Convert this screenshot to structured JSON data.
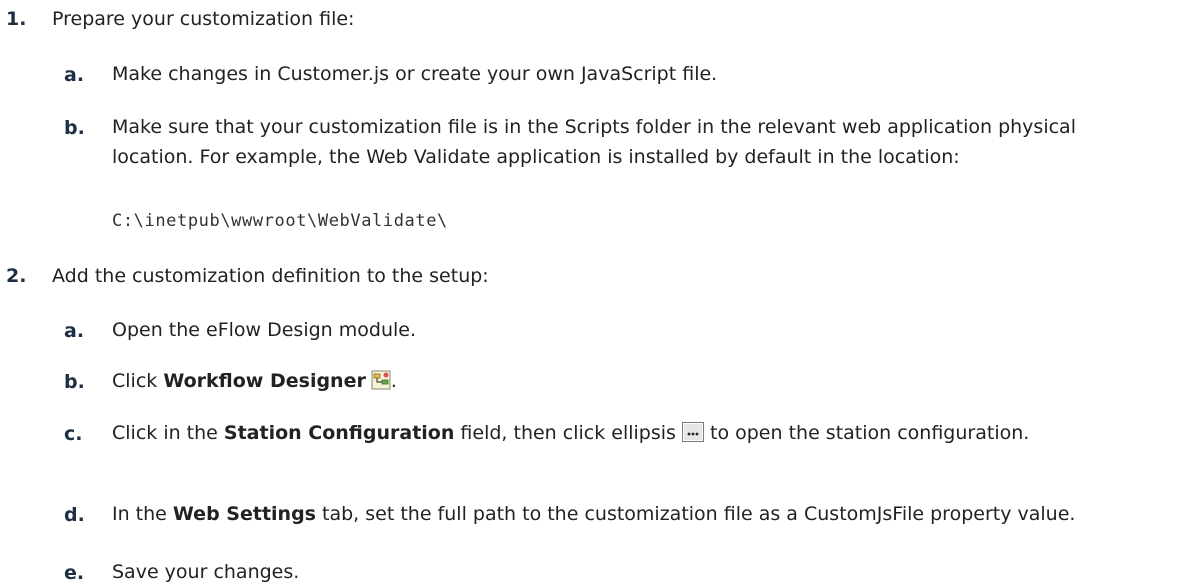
{
  "steps": [
    {
      "number": "1.",
      "text": "Prepare your customization file:",
      "substeps": [
        {
          "letter": "a.",
          "text": "Make changes in Customer.js or create your own JavaScript file."
        },
        {
          "letter": "b.",
          "text": "Make sure that your customization file is in the Scripts folder in the relevant web application physical location. For example, the Web Validate application is installed by default in the location:",
          "code": "C:\\inetpub\\wwwroot\\WebValidate\\"
        }
      ]
    },
    {
      "number": "2.",
      "text": "Add the customization definition to the setup:",
      "substeps": [
        {
          "letter": "a.",
          "text": "Open the eFlow Design module."
        },
        {
          "letter": "b.",
          "prefix": "Click ",
          "bold": "Workflow Designer",
          "suffix": "."
        },
        {
          "letter": "c.",
          "prefix": "Click in the ",
          "bold": "Station Configuration",
          "middle": " field, then click ellipsis ",
          "suffix": " to open the station configuration."
        },
        {
          "letter": "d.",
          "prefix": "In the ",
          "bold": "Web Settings",
          "suffix": " tab, set the full path to the customization file as a CustomJsFile property value."
        },
        {
          "letter": "e.",
          "text": "Save your changes."
        }
      ]
    }
  ],
  "icons": {
    "workflow_designer": "workflow-designer-icon",
    "ellipsis": "ellipsis-button-icon"
  }
}
